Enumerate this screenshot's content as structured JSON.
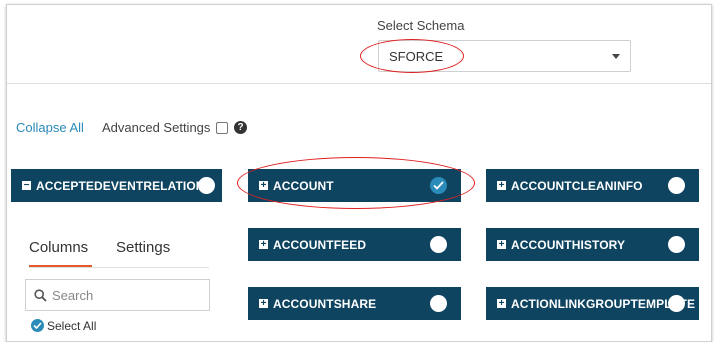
{
  "schema": {
    "label": "Select Schema",
    "value": "SFORCE"
  },
  "controls": {
    "collapse_all": "Collapse All",
    "advanced_settings": "Advanced Settings",
    "help_symbol": "?"
  },
  "expanded_table": {
    "name": "ACCEPTEDEVENTRELATION",
    "tabs": [
      "Columns",
      "Settings"
    ],
    "active_tab": "Columns",
    "search_placeholder": "Search",
    "select_all": "Select All"
  },
  "tables": [
    {
      "name": "ACCOUNT",
      "selected": true
    },
    {
      "name": "ACCOUNTCLEANINFO",
      "selected": false
    },
    {
      "name": "ACCOUNTFEED",
      "selected": false
    },
    {
      "name": "ACCOUNTHISTORY",
      "selected": false
    },
    {
      "name": "ACCOUNTSHARE",
      "selected": false
    },
    {
      "name": "ACTIONLINKGROUPTEMPLATE",
      "selected": false
    }
  ],
  "colors": {
    "header_bg": "#0f4461",
    "accent_blue": "#2a8ab8",
    "active_tab": "#e4582b",
    "annotation": "#e02020"
  },
  "icons": {
    "expand": "plus-square-icon",
    "collapse": "minus-square-icon",
    "selected": "checkmark-circle-icon",
    "search": "search-icon",
    "help": "question-circle-icon",
    "dropdown": "caret-down-icon"
  }
}
